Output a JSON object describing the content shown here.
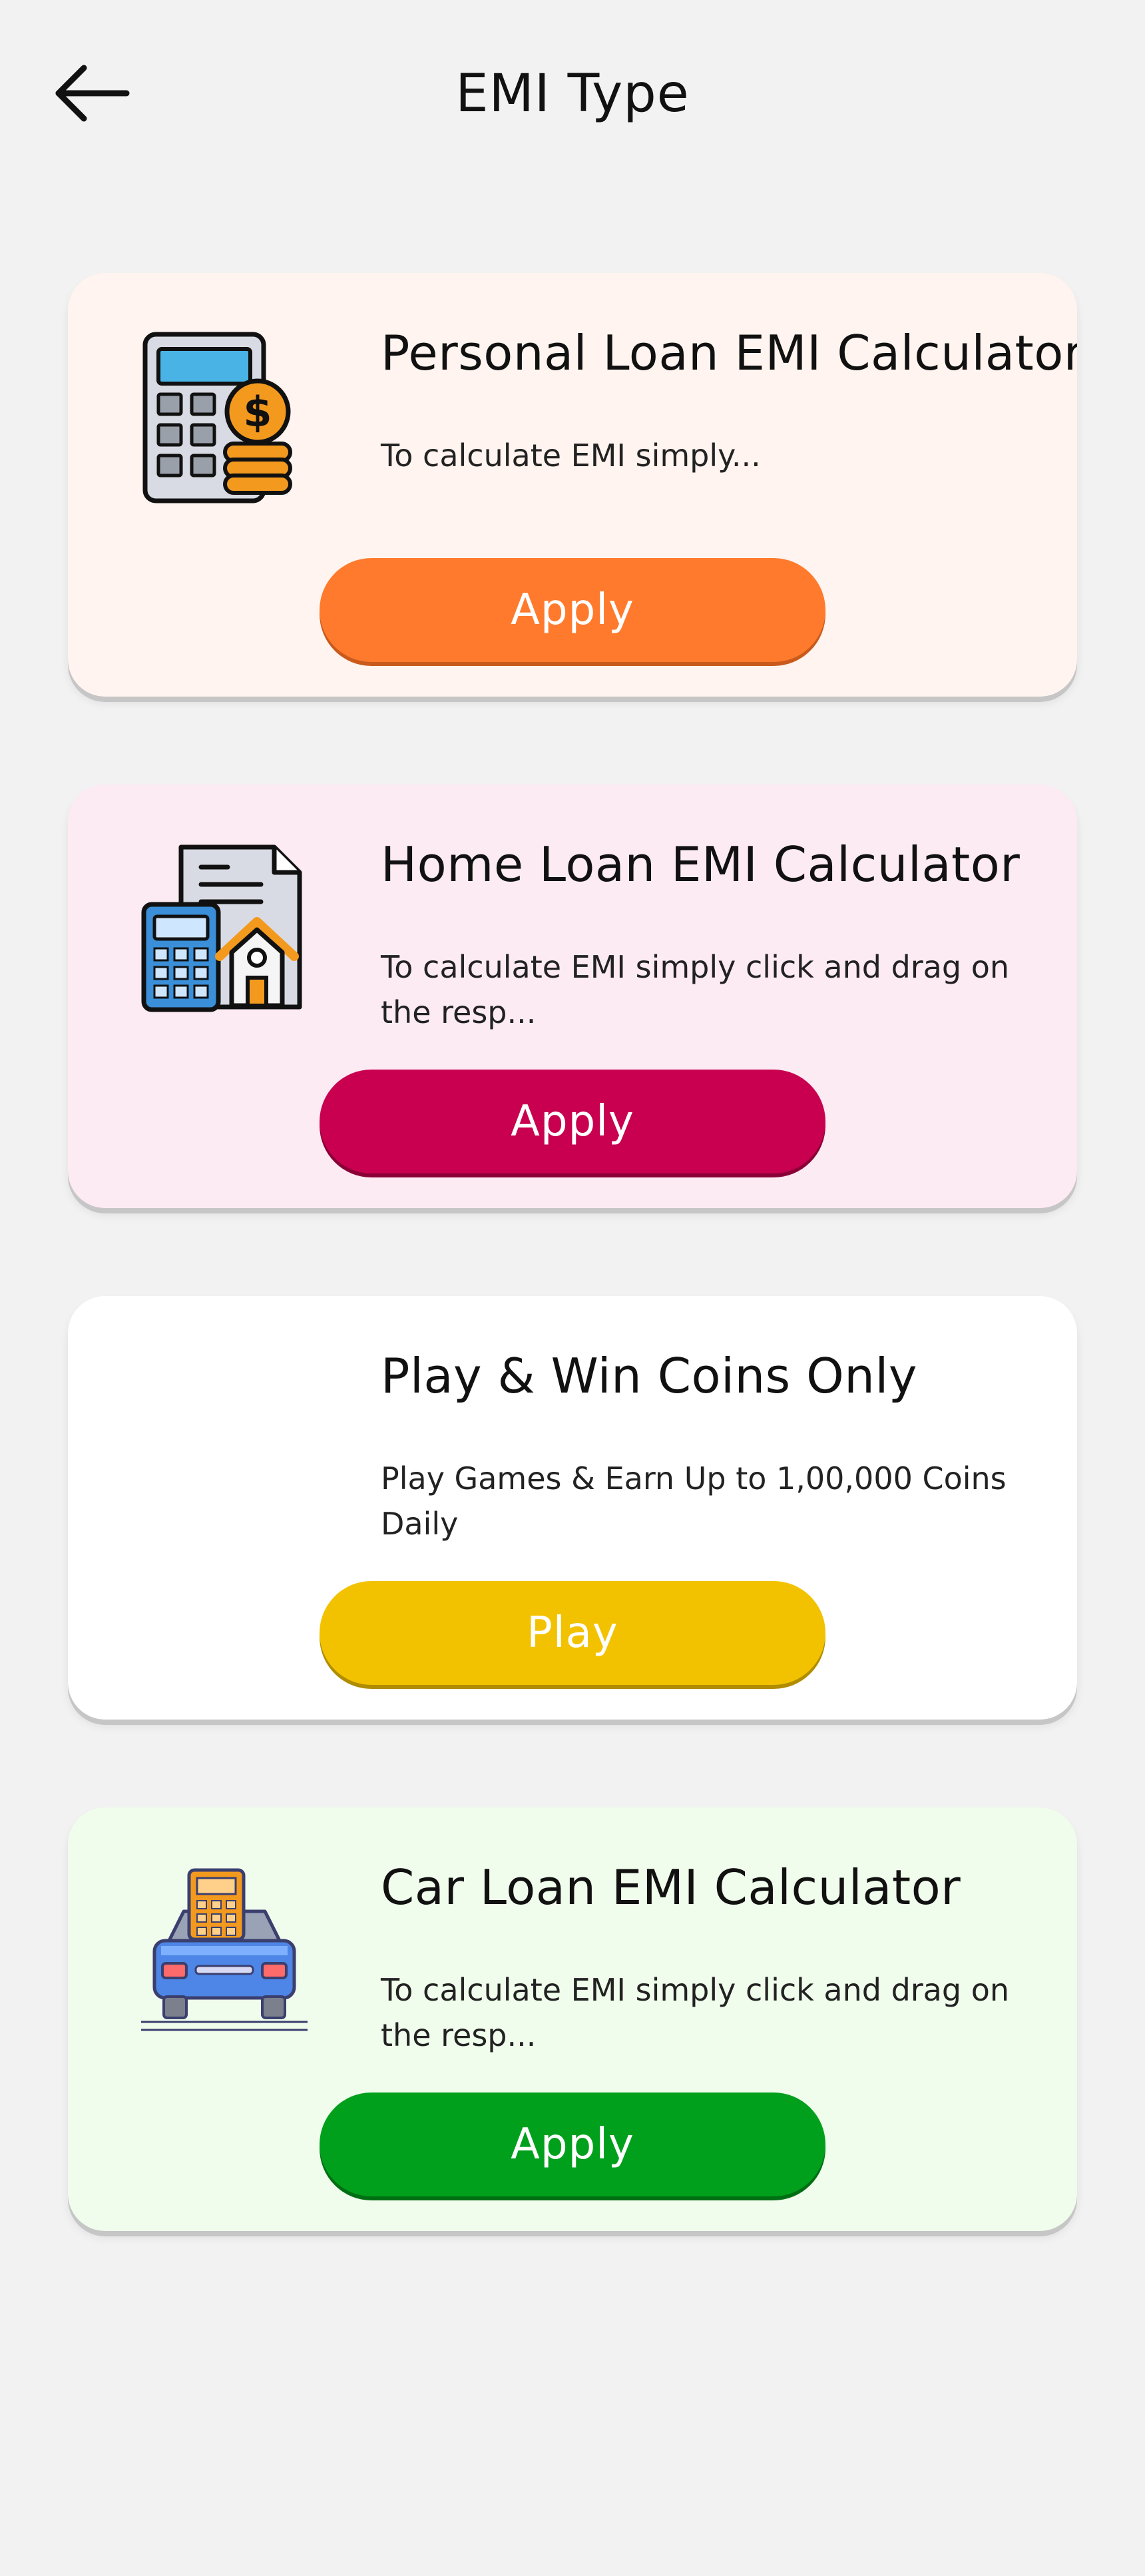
{
  "header": {
    "title": "EMI Type"
  },
  "cards": [
    {
      "title": "Personal Loan EMI Calculator",
      "description": "To calculate EMI simply...",
      "button": "Apply",
      "icon": "calculator-coins-icon",
      "background": "#fff4ef",
      "button_color": "#ff7a2c",
      "button_shadow": "#c95a1c"
    },
    {
      "title": "Home Loan EMI Calculator",
      "description": "To calculate EMI simply click and drag on the resp...",
      "button": "Apply",
      "icon": "home-loan-calculator-icon",
      "background": "#fdebf3",
      "button_color": "#c8004f",
      "button_shadow": "#8a0036"
    },
    {
      "title": "Play & Win Coins Only",
      "description": "Play Games & Earn Up to 1,00,000 Coins Daily",
      "button": "Play",
      "icon": "",
      "background": "#ffffff",
      "button_color": "#f2c200",
      "button_shadow": "#b08c00"
    },
    {
      "title": "Car Loan EMI Calculator",
      "description": "To calculate EMI simply click and drag on the resp...",
      "button": "Apply",
      "icon": "car-calculator-icon",
      "background": "#f0fcec",
      "button_color": "#00a01c",
      "button_shadow": "#006e12"
    }
  ]
}
